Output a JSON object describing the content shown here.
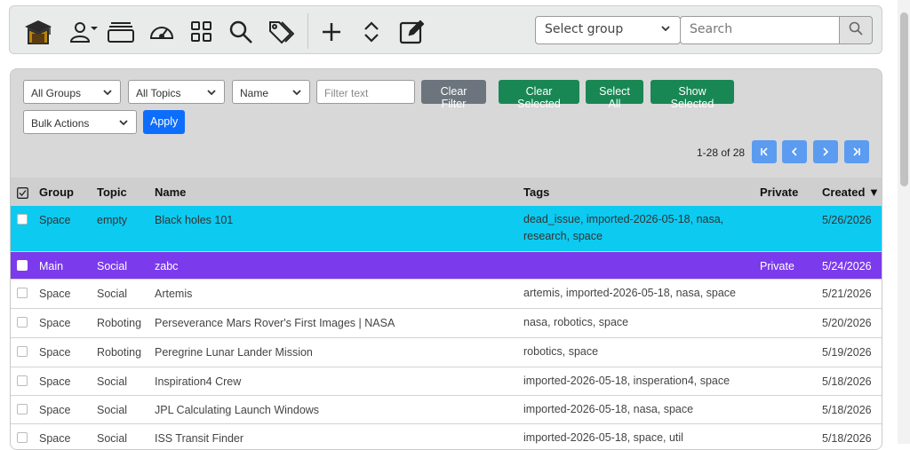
{
  "toolbar": {
    "icons": [
      "graduation-cap-logo",
      "user-icon",
      "chevron-down-icon",
      "window-stack-icon",
      "speedometer-icon",
      "grid-icon",
      "search-icon",
      "tags-icon",
      "plus-icon",
      "expand-collapse-icon",
      "edit-icon"
    ],
    "group_select": "Select group",
    "search_placeholder": "Search"
  },
  "filters": {
    "groups": "All Groups",
    "topics": "All Topics",
    "name": "Name",
    "filter_placeholder": "Filter text",
    "clear_filter": "Clear Filter",
    "clear_selected": "Clear Selected",
    "select_all": "Select All",
    "show_selected": "Show Selected",
    "bulk_actions": "Bulk Actions",
    "apply": "Apply"
  },
  "pager": {
    "summary": "1-28 of 28"
  },
  "table": {
    "headers": {
      "group": "Group",
      "topic": "Topic",
      "name": "Name",
      "tags": "Tags",
      "private": "Private",
      "created": "Created ▼"
    },
    "rows": [
      {
        "group": "Space",
        "topic": "empty",
        "name": "Black holes 101",
        "tags": "dead_issue, imported-2026-05-18, nasa, research, space",
        "private": "",
        "created": "5/26/2026"
      },
      {
        "group": "Main",
        "topic": "Social",
        "name": "zabc",
        "tags": "",
        "private": "Private",
        "created": "5/24/2026"
      },
      {
        "group": "Space",
        "topic": "Social",
        "name": "Artemis",
        "tags": "artemis, imported-2026-05-18, nasa, space",
        "private": "",
        "created": "5/21/2026"
      },
      {
        "group": "Space",
        "topic": "Roboting",
        "name": "Perseverance Mars Rover's First Images | NASA",
        "tags": "nasa, robotics, space",
        "private": "",
        "created": "5/20/2026"
      },
      {
        "group": "Space",
        "topic": "Roboting",
        "name": "Peregrine Lunar Lander Mission",
        "tags": "robotics, space",
        "private": "",
        "created": "5/19/2026"
      },
      {
        "group": "Space",
        "topic": "Social",
        "name": "Inspiration4 Crew",
        "tags": "imported-2026-05-18, insperation4, space",
        "private": "",
        "created": "5/18/2026"
      },
      {
        "group": "Space",
        "topic": "Social",
        "name": "JPL Calculating Launch Windows",
        "tags": "imported-2026-05-18, nasa, space",
        "private": "",
        "created": "5/18/2026"
      },
      {
        "group": "Space",
        "topic": "Social",
        "name": "ISS Transit Finder",
        "tags": "imported-2026-05-18, space, util",
        "private": "",
        "created": "5/18/2026"
      }
    ]
  },
  "colors": {
    "cyan_row": "#0dcaf0",
    "purple_row": "#7c3aed",
    "green_button": "#198754",
    "blue_button": "#0d6efd",
    "pager_button": "#5b9cf0"
  }
}
